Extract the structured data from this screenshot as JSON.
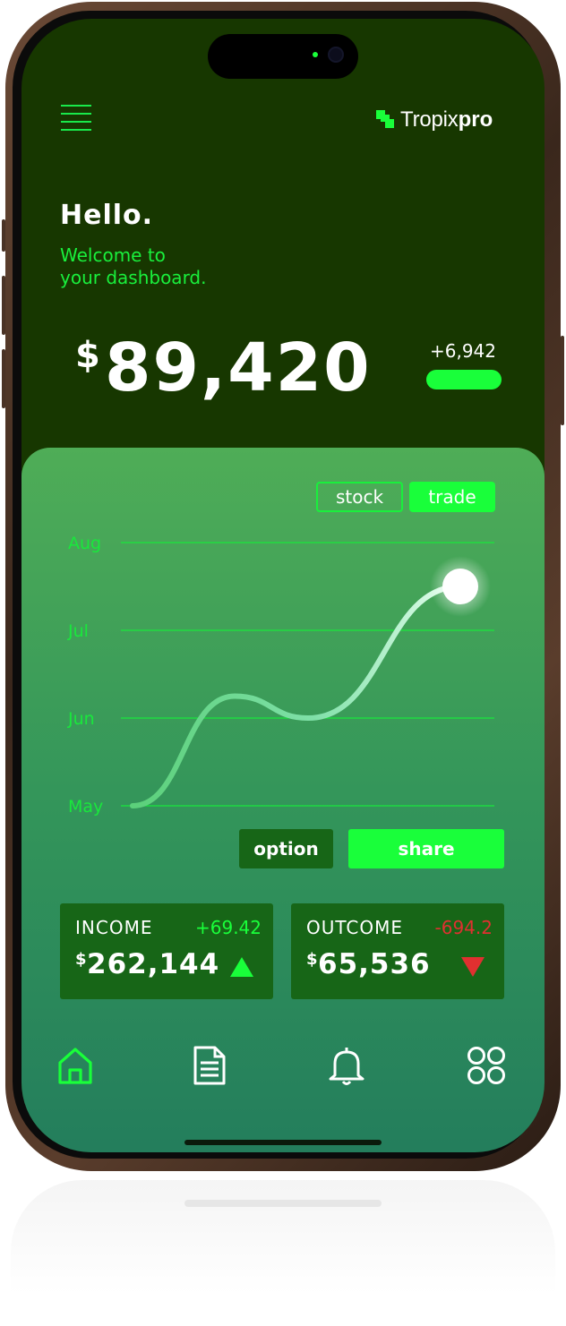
{
  "brand": {
    "name": "Tropix",
    "name_bold": "pro"
  },
  "greeting": {
    "title": "Hello.",
    "subtitle_line1": "Welcome to",
    "subtitle_line2": "your dashboard."
  },
  "balance": {
    "currency": "$",
    "value": "89,420",
    "change": "+6,942"
  },
  "tabs": {
    "stock": "stock",
    "trade": "trade"
  },
  "chart_data": {
    "type": "line",
    "y_categories": [
      "May",
      "Jun",
      "Jul",
      "Aug"
    ],
    "series": [
      {
        "values": [
          0.0,
          1.25,
          1.0,
          2.5
        ]
      }
    ],
    "grid": true
  },
  "actions": {
    "option": "option",
    "share": "share"
  },
  "income": {
    "label": "INCOME",
    "change": "+69.42",
    "currency": "$",
    "value": "262,144",
    "trend": "up"
  },
  "outcome": {
    "label": "OUTCOME",
    "change": "-694.2",
    "currency": "$",
    "value": "65,536",
    "trend": "down"
  },
  "nav": [
    "home-icon",
    "document-icon",
    "bell-icon",
    "apps-grid-icon"
  ],
  "colors": {
    "accent": "#19ff3a",
    "background_dark": "#173700",
    "card_dark": "#176617",
    "negative": "#e03030"
  }
}
